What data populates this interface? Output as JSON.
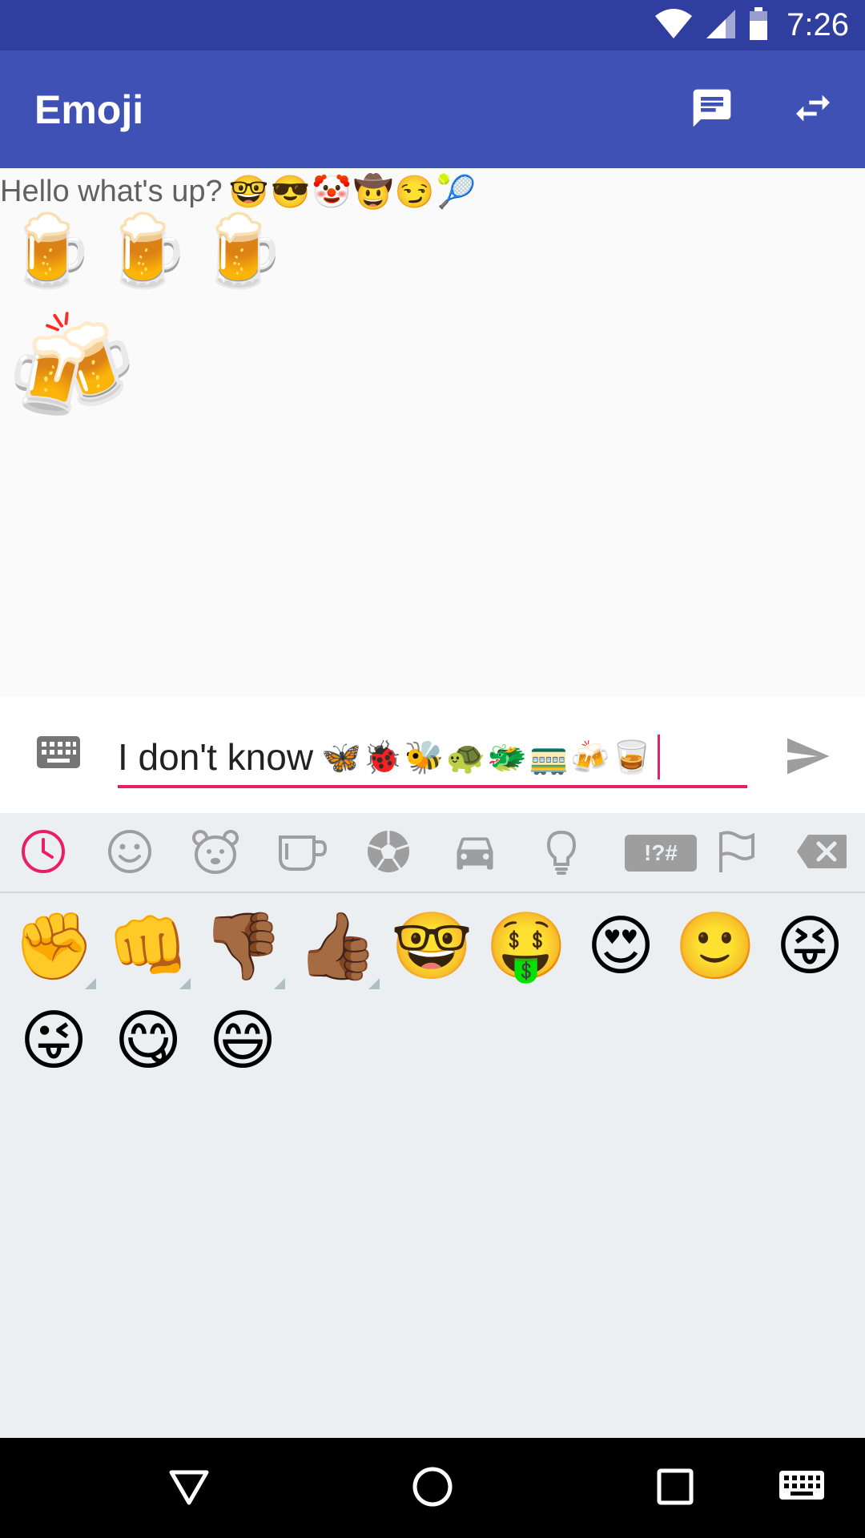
{
  "status_bar": {
    "time": "7:26",
    "icons": [
      "wifi-icon",
      "signal-icon",
      "battery-icon"
    ]
  },
  "app_bar": {
    "title": "Emoji",
    "actions": [
      "chat-icon",
      "swap-icon"
    ]
  },
  "messages": {
    "line1_text": "Hello what's up?",
    "line1_emojis": "🤓😎🤡🤠😏🎾",
    "beers": "🍺🍺🍺",
    "cheers": "🍻"
  },
  "compose": {
    "text": "I don't know",
    "emojis": "🦋🐞🐝🐢🐲🚃🍻🥃"
  },
  "keyboard": {
    "selected_tab": "recent",
    "tabs": [
      "recent-icon",
      "smiley-icon",
      "animal-icon",
      "food-icon",
      "sports-icon",
      "car-icon",
      "bulb-icon",
      "symbols-icon",
      "flag-icon",
      "backspace-icon"
    ],
    "symbols_label": "!?#",
    "emojis": [
      "✊",
      "👊",
      "👎🏾",
      "👍🏾",
      "🤓",
      "🤑",
      "😍",
      "🙂",
      "😝",
      "😜",
      "😋",
      "😄"
    ]
  },
  "nav_bar": [
    "back-icon",
    "home-icon",
    "recents-icon",
    "keyboard-switch-icon"
  ],
  "colors": {
    "primary": "#3f51b5",
    "primary_dark": "#303f9f",
    "accent": "#e91e63"
  }
}
